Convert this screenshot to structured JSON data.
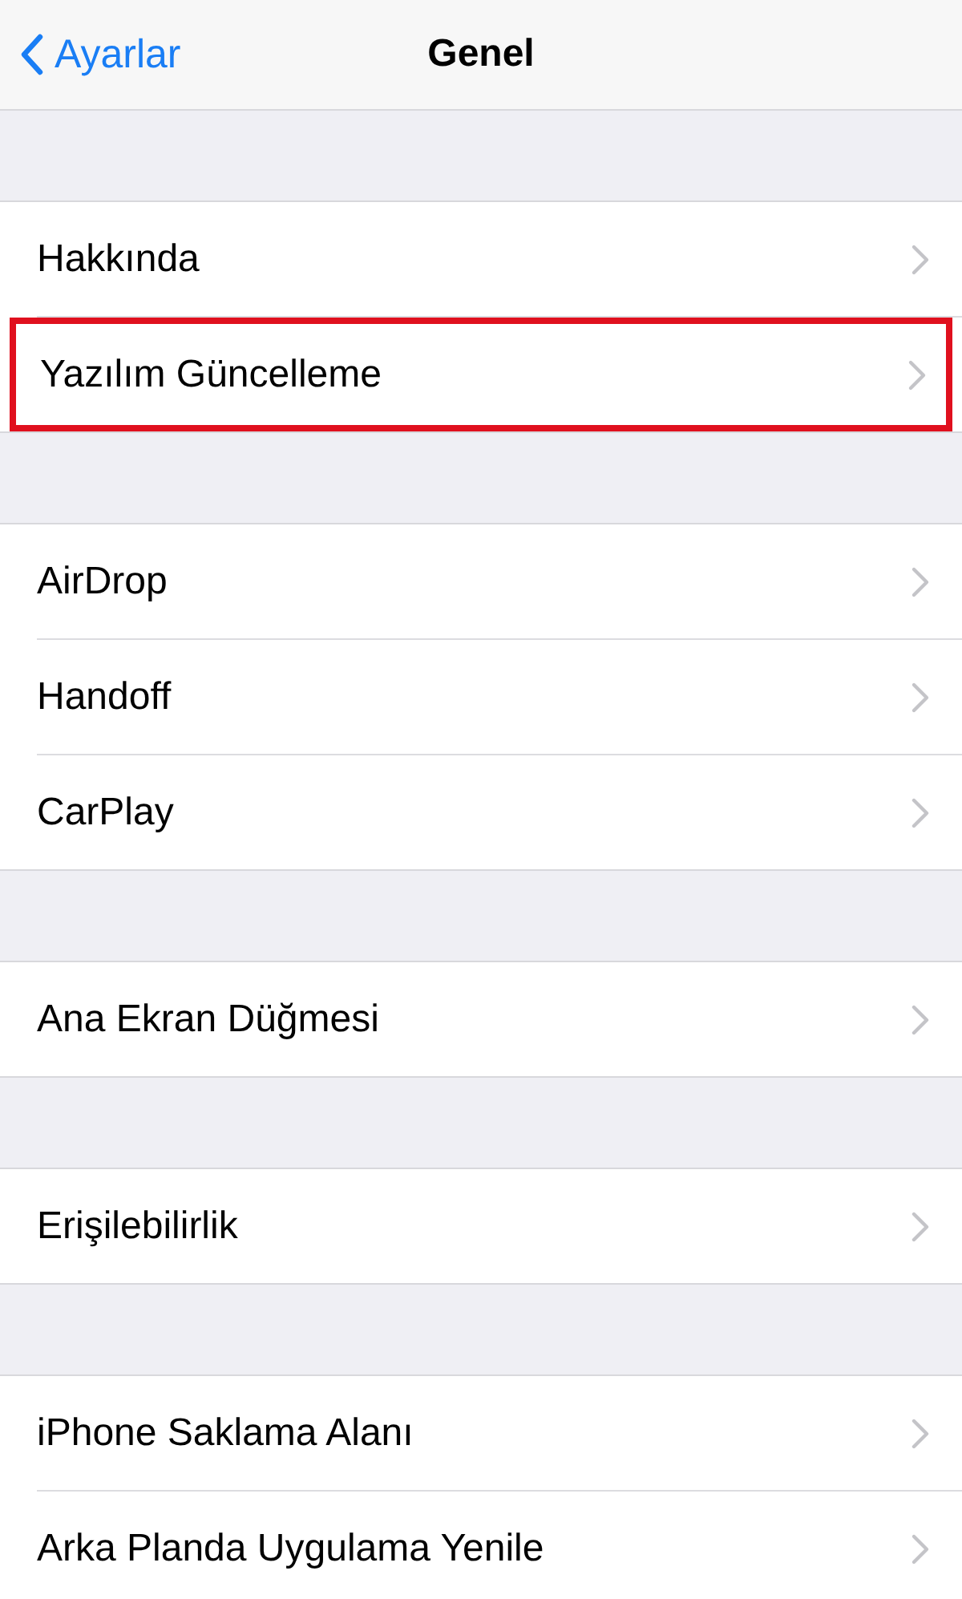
{
  "nav": {
    "back": "Ayarlar",
    "title": "Genel"
  },
  "groups": [
    {
      "rows": [
        {
          "label": "Hakkında",
          "highlighted": false
        },
        {
          "label": "Yazılım Güncelleme",
          "highlighted": true
        }
      ]
    },
    {
      "rows": [
        {
          "label": "AirDrop",
          "highlighted": false
        },
        {
          "label": "Handoff",
          "highlighted": false
        },
        {
          "label": "CarPlay",
          "highlighted": false
        }
      ]
    },
    {
      "rows": [
        {
          "label": "Ana Ekran Düğmesi",
          "highlighted": false
        }
      ]
    },
    {
      "rows": [
        {
          "label": "Erişilebilirlik",
          "highlighted": false
        }
      ]
    },
    {
      "rows": [
        {
          "label": "iPhone Saklama Alanı",
          "highlighted": false
        },
        {
          "label": "Arka Planda Uygulama Yenile",
          "highlighted": false
        }
      ]
    }
  ]
}
